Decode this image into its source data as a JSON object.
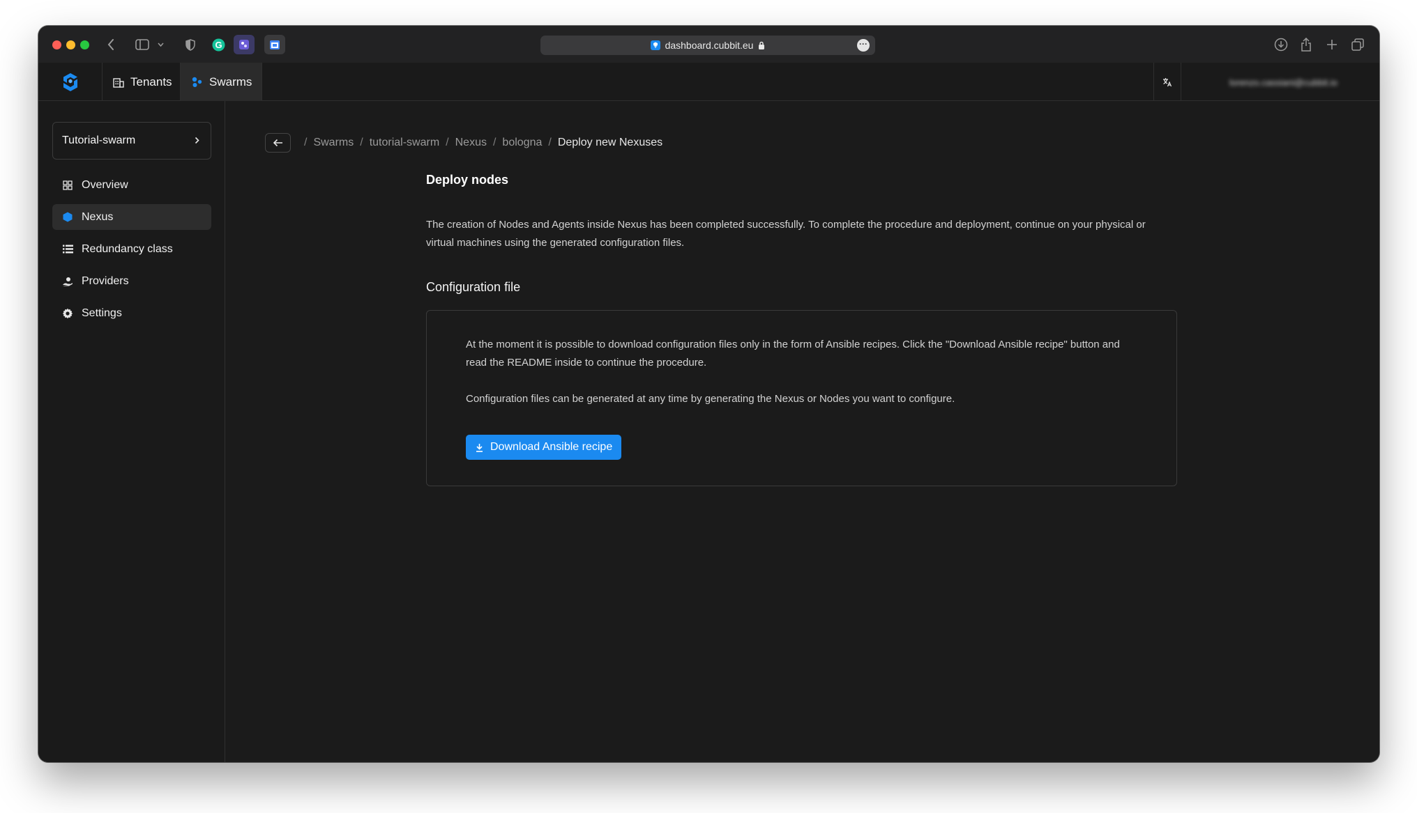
{
  "browser": {
    "url": "dashboard.cubbit.eu",
    "colors": {
      "red": "#fe5f57",
      "yellow": "#febc2e",
      "green": "#28c840"
    }
  },
  "header": {
    "tabs": [
      {
        "label": "Tenants",
        "icon": "building-icon"
      },
      {
        "label": "Swarms",
        "icon": "swarm-icon"
      }
    ],
    "user_label": "lorenzo.cassiani@cubbit.io"
  },
  "sidebar": {
    "swarm_name": "Tutorial-swarm",
    "items": [
      {
        "label": "Overview",
        "icon": "grid-icon"
      },
      {
        "label": "Nexus",
        "icon": "hexagon-icon"
      },
      {
        "label": "Redundancy class",
        "icon": "list-icon"
      },
      {
        "label": "Providers",
        "icon": "provider-icon"
      },
      {
        "label": "Settings",
        "icon": "gear-icon"
      }
    ]
  },
  "breadcrumb": {
    "sep": "/",
    "items": [
      "Swarms",
      "tutorial-swarm",
      "Nexus",
      "bologna",
      "Deploy new Nexuses"
    ]
  },
  "content": {
    "title": "Deploy nodes",
    "intro": "The creation of Nodes and Agents inside Nexus has been completed successfully. To complete the procedure and deployment, continue on your physical or virtual machines using the generated configuration files.",
    "config_title": "Configuration file",
    "config_p1": "At the moment it is possible to download configuration files only in the form of Ansible recipes. Click the \"Download Ansible recipe\" button and read the README inside to continue the procedure.",
    "config_p2": "Configuration files can be generated at any time by generating the Nexus or Nodes you want to configure.",
    "download_label": "Download Ansible recipe"
  },
  "theme": {
    "accent": "#1b8af0",
    "background": "#1b1b1b"
  }
}
